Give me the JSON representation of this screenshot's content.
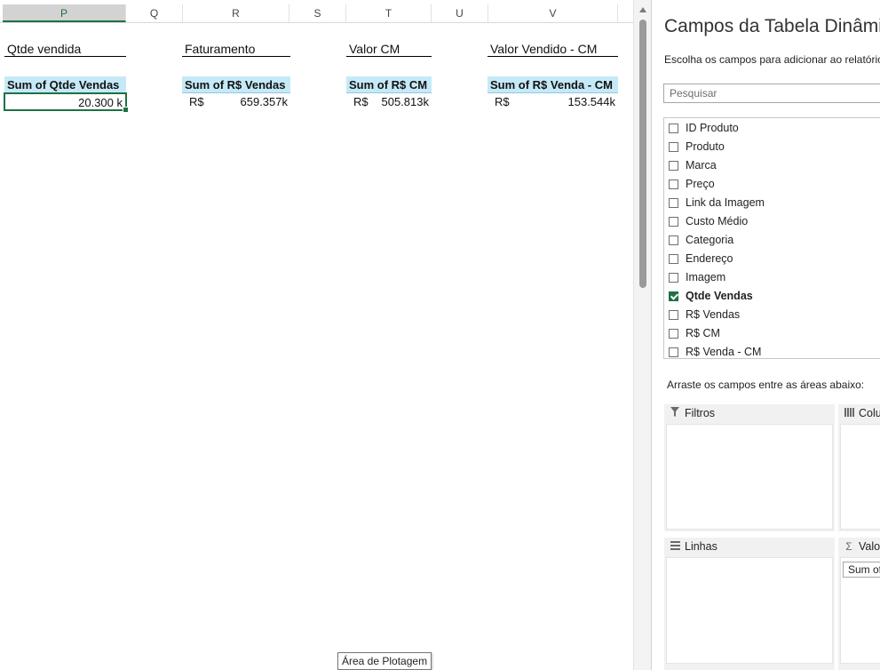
{
  "columns": [
    {
      "label": "P",
      "selected": true
    },
    {
      "label": "Q",
      "selected": false
    },
    {
      "label": "R",
      "selected": false
    },
    {
      "label": "S",
      "selected": false
    },
    {
      "label": "T",
      "selected": false
    },
    {
      "label": "U",
      "selected": false
    },
    {
      "label": "V",
      "selected": false
    }
  ],
  "sheet": {
    "blocks": [
      {
        "title": "Qtde vendida",
        "header": "Sum of Qtde Vendas",
        "currency": "",
        "value": "20.300 k"
      },
      {
        "title": "Faturamento",
        "header": "Sum of R$ Vendas",
        "currency": "R$",
        "value": "659.357k"
      },
      {
        "title": "Valor CM",
        "header": "Sum of R$ CM",
        "currency": "R$",
        "value": "505.813k"
      },
      {
        "title": "Valor Vendido - CM",
        "header": "Sum of R$ Venda - CM",
        "currency": "R$",
        "value": "153.544k"
      }
    ],
    "tooltip": "Área de Plotagem"
  },
  "pane": {
    "title": "Campos da Tabela Dinâmica",
    "subtitle": "Escolha os campos para adicionar ao relatório:",
    "search_placeholder": "Pesquisar",
    "fields": [
      {
        "label": "ID Produto",
        "checked": false
      },
      {
        "label": "Produto",
        "checked": false
      },
      {
        "label": "Marca",
        "checked": false
      },
      {
        "label": "Preço",
        "checked": false
      },
      {
        "label": "Link da Imagem",
        "checked": false
      },
      {
        "label": "Custo Médio",
        "checked": false
      },
      {
        "label": "Categoria",
        "checked": false
      },
      {
        "label": "Endereço",
        "checked": false
      },
      {
        "label": "Imagem",
        "checked": false
      },
      {
        "label": "Qtde Vendas",
        "checked": true
      },
      {
        "label": "R$ Vendas",
        "checked": false
      },
      {
        "label": "R$ CM",
        "checked": false
      },
      {
        "label": "R$ Venda - CM",
        "checked": false
      }
    ],
    "drag_hint": "Arraste os campos entre as áreas abaixo:",
    "areas": {
      "filters": "Filtros",
      "columns": "Colunas",
      "rows": "Linhas",
      "values": "Valores",
      "values_item": "Sum of Qtde Vendas"
    }
  },
  "colors": {
    "accent": "#1e7145",
    "pivot_header": "#c6e9f7"
  }
}
